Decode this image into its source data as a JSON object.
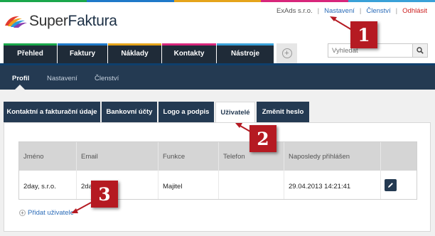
{
  "brand": {
    "name_part1": "Super",
    "name_part2": "Faktura"
  },
  "topnav": {
    "company": "ExAds s.r.o.",
    "settings": "Nastavení",
    "membership": "Členství",
    "logout": "Odhlásit",
    "separator": "|"
  },
  "main_tabs": [
    {
      "label": "Přehled",
      "accent": "#1aa74b"
    },
    {
      "label": "Faktury",
      "accent": "#1f79c9"
    },
    {
      "label": "Náklady",
      "accent": "#e5a41b"
    },
    {
      "label": "Kontakty",
      "accent": "#d8267b"
    },
    {
      "label": "Nástroje",
      "accent": "#3aa1d8"
    }
  ],
  "search": {
    "placeholder": "Vyhledat"
  },
  "sub_tabs": {
    "profile": "Profil",
    "settings": "Nastavení",
    "membership": "Členství"
  },
  "profile_tabs": [
    {
      "label": "Kontaktní a fakturační údaje"
    },
    {
      "label": "Bankovní účty"
    },
    {
      "label": "Logo a podpis"
    },
    {
      "label": "Uživatelé",
      "active": true
    },
    {
      "label": "Změnit heslo"
    }
  ],
  "users_table": {
    "headers": [
      "Jméno",
      "Email",
      "Funkce",
      "Telefon",
      "Naposledy přihlášen"
    ],
    "rows": [
      {
        "name": "2day, s.r.o.",
        "email": "2day",
        "role": "Majitel",
        "phone": "",
        "last_login": "29.04.2013 14:21:41"
      }
    ]
  },
  "add_user": {
    "label": "Přidat uživatele"
  },
  "markers": [
    "1",
    "2",
    "3"
  ],
  "colors": {
    "navy": "#243a52",
    "dark_tab": "#1f2b38",
    "marker_red": "#b51a22",
    "link_blue": "#2a6bb8",
    "logout_red": "#cc1f1f"
  }
}
